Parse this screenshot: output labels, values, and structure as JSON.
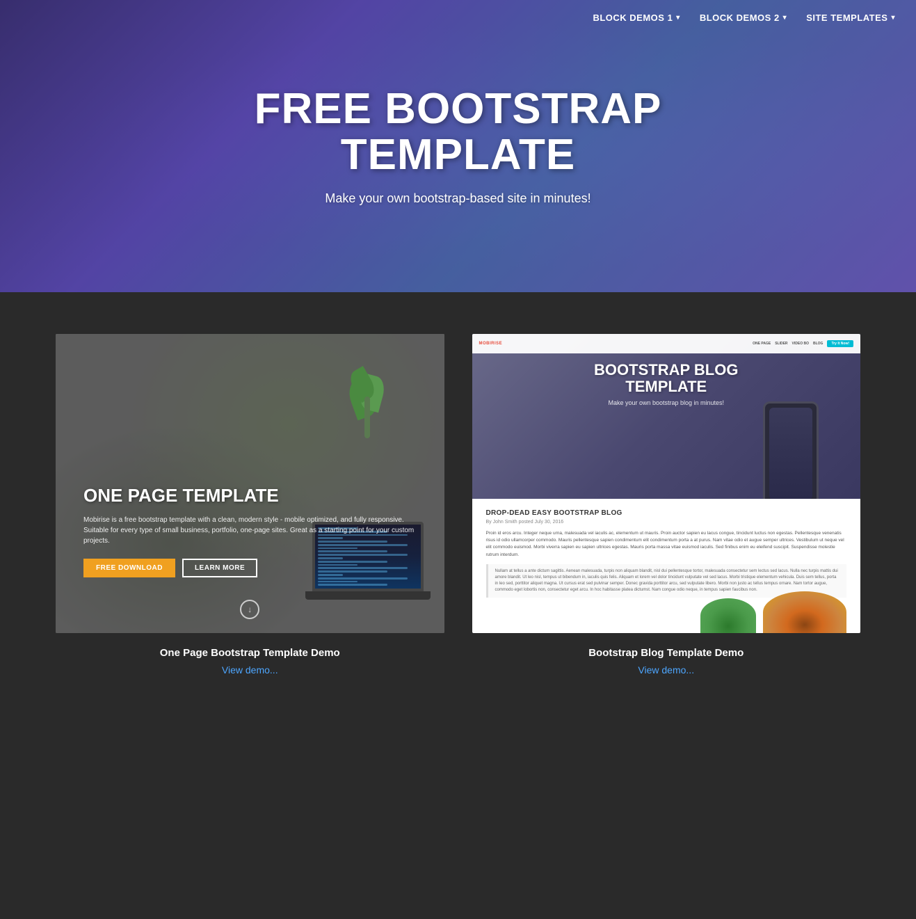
{
  "nav": {
    "items": [
      {
        "label": "BLOCK DEMOS 1",
        "has_dropdown": true
      },
      {
        "label": "BLOCK DEMOS 2",
        "has_dropdown": true
      },
      {
        "label": "SITE TEMPLATES",
        "has_dropdown": true
      }
    ]
  },
  "hero": {
    "title": "FREE BOOTSTRAP\nTEMPLATE",
    "subtitle": "Make your own bootstrap-based site in minutes!"
  },
  "cards": [
    {
      "id": "one-page",
      "template_label": "ONE PAGE TEMPLATE",
      "template_desc": "Mobirise is a free bootstrap template with a clean, modern style - mobile optimized, and fully responsive. Suitable for every type of small business, portfolio, one-page sites. Great as a starting point for your custom projects.",
      "btn_download": "FREE DOWNLOAD",
      "btn_learn": "LEARN MORE",
      "caption_title": "One Page Bootstrap Template Demo",
      "caption_link": "View demo..."
    },
    {
      "id": "blog",
      "blog_nav_logo": "MOBIRISE",
      "blog_nav_links": [
        "ONE PAGE",
        "SLIDER",
        "VIDEO BO",
        "BLOG"
      ],
      "blog_nav_cta": "Try It Now!",
      "blog_top_title": "BOOTSTRAP BLOG\nTEMPLATE",
      "blog_top_subtitle": "Make your own bootstrap blog in minutes!",
      "blog_post_title": "DROP-DEAD EASY BOOTSTRAP BLOG",
      "blog_post_meta": "By John Smith posted July 30, 2016",
      "blog_post_body1": "Proin id eros arcu. Integer neque urna, malesuada vel iaculis ac, elementum ut mauris. Proin auctor sapien eu lacus congue, tincidunt luctus non egestas. Pellentesque venenatis risus id odio ullamcorper commodo. Mauris pellentesque sapien condimentum elit condimentum porta a at purus. Nam vitae odio et augue semper ultrices. Vestibulum ut neque vel elit commodo euismod. Morbi viverra sapien eu sapien ultrices egestas. Mauris porta massa vitae euismod iaculis. Sed finibus enim eu eleifend suscipit. Suspendisse molestie rutrum interdum.",
      "blog_blockquote": "Nullam at tellus a ante dictum sagittis. Aenean malesuada, turpis non aliquam blandit, nisl dui pellentesque tortor, malesuada consectetur sem lectus sed lacus. Nulla nec turpis mattis dui amore blandit. Ut leo nisl, tempus ut bibendum in, iaculis quis felis. Aliquam et lorem vel dolor tincidunt vulputate vel sed lacus. Morbi tristique elementum vehicula. Duis sem tellus, porta in leo sed, porttitor aliquet magna. Ut cursus erat sed pulvinar semper. Donec gravida porttitor arcu, sed vulputate libero. Morbi non justo ac tellus tempus ornare. Nam tortor augue, commodo eget lobortis non, consectetur eget arcu. In hoc habitasse platea dictumst. Nam congue odio neque, in tempus sapien faucibus non.",
      "caption_title": "Bootstrap Blog Template Demo",
      "caption_link": "View demo..."
    }
  ]
}
